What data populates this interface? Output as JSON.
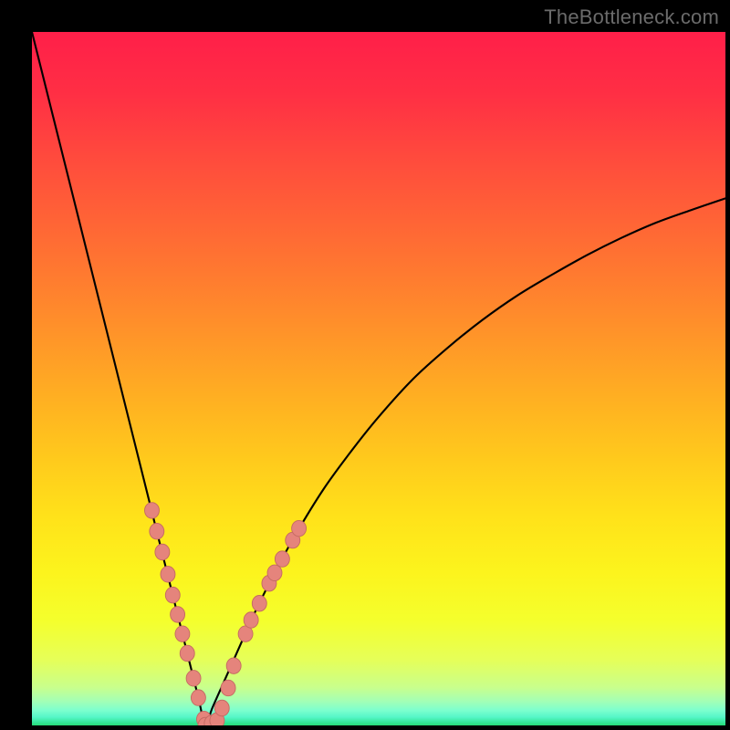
{
  "watermark": "TheBottleneck.com",
  "colors": {
    "frame": "#000000",
    "curve_stroke": "#000000",
    "marker_fill": "#e5847c",
    "marker_stroke": "#c46a62",
    "watermark": "#6b6b6b"
  },
  "gradient_stops": [
    {
      "offset": 0.0,
      "color": "#ff1f49"
    },
    {
      "offset": 0.09,
      "color": "#ff2f44"
    },
    {
      "offset": 0.18,
      "color": "#ff4a3d"
    },
    {
      "offset": 0.27,
      "color": "#ff6336"
    },
    {
      "offset": 0.36,
      "color": "#ff7d2f"
    },
    {
      "offset": 0.45,
      "color": "#ff9828"
    },
    {
      "offset": 0.54,
      "color": "#ffb321"
    },
    {
      "offset": 0.62,
      "color": "#ffcb1c"
    },
    {
      "offset": 0.7,
      "color": "#ffe21a"
    },
    {
      "offset": 0.78,
      "color": "#fcf41d"
    },
    {
      "offset": 0.85,
      "color": "#f4ff2d"
    },
    {
      "offset": 0.905,
      "color": "#e6ff58"
    },
    {
      "offset": 0.945,
      "color": "#c9ff8c"
    },
    {
      "offset": 0.965,
      "color": "#a3ffb6"
    },
    {
      "offset": 0.978,
      "color": "#7dffce"
    },
    {
      "offset": 0.988,
      "color": "#56f7c8"
    },
    {
      "offset": 0.995,
      "color": "#37e79c"
    },
    {
      "offset": 1.0,
      "color": "#27db78"
    }
  ],
  "chart_data": {
    "type": "line",
    "title": "",
    "xlabel": "",
    "ylabel": "",
    "xlim": [
      0,
      100
    ],
    "ylim": [
      0,
      100
    ],
    "grid": false,
    "legend": false,
    "x_minimum": 25,
    "series": [
      {
        "name": "bottleneck-curve",
        "x": [
          0,
          2,
          4,
          6,
          8,
          10,
          12,
          14,
          16,
          18,
          20,
          22,
          24,
          25,
          26,
          28,
          30,
          32,
          35,
          38,
          42,
          46,
          50,
          55,
          60,
          65,
          70,
          75,
          80,
          85,
          90,
          95,
          100
        ],
        "y": [
          100,
          92,
          84,
          76,
          68,
          60,
          52,
          44,
          36,
          28,
          20,
          12,
          4,
          0,
          2.5,
          7,
          11.5,
          16,
          22,
          27.5,
          34,
          39.5,
          44.5,
          50,
          54.5,
          58.5,
          62,
          65,
          67.8,
          70.3,
          72.5,
          74.3,
          76
        ]
      }
    ],
    "markers": [
      {
        "x": 17.3,
        "y": 31.0
      },
      {
        "x": 18.0,
        "y": 28.0
      },
      {
        "x": 18.8,
        "y": 25.0
      },
      {
        "x": 19.6,
        "y": 21.8
      },
      {
        "x": 20.3,
        "y": 18.8
      },
      {
        "x": 21.0,
        "y": 16.0
      },
      {
        "x": 21.7,
        "y": 13.2
      },
      {
        "x": 22.4,
        "y": 10.4
      },
      {
        "x": 23.3,
        "y": 6.8
      },
      {
        "x": 24.0,
        "y": 4.0
      },
      {
        "x": 24.8,
        "y": 0.9
      },
      {
        "x": 25.0,
        "y": 0.0
      },
      {
        "x": 25.9,
        "y": 0.3
      },
      {
        "x": 26.7,
        "y": 0.7
      },
      {
        "x": 27.4,
        "y": 2.5
      },
      {
        "x": 28.3,
        "y": 5.4
      },
      {
        "x": 29.1,
        "y": 8.6
      },
      {
        "x": 30.8,
        "y": 13.2
      },
      {
        "x": 31.6,
        "y": 15.2
      },
      {
        "x": 32.8,
        "y": 17.6
      },
      {
        "x": 34.2,
        "y": 20.5
      },
      {
        "x": 35.0,
        "y": 22.0
      },
      {
        "x": 36.1,
        "y": 24.0
      },
      {
        "x": 37.6,
        "y": 26.7
      },
      {
        "x": 38.5,
        "y": 28.4
      }
    ]
  }
}
